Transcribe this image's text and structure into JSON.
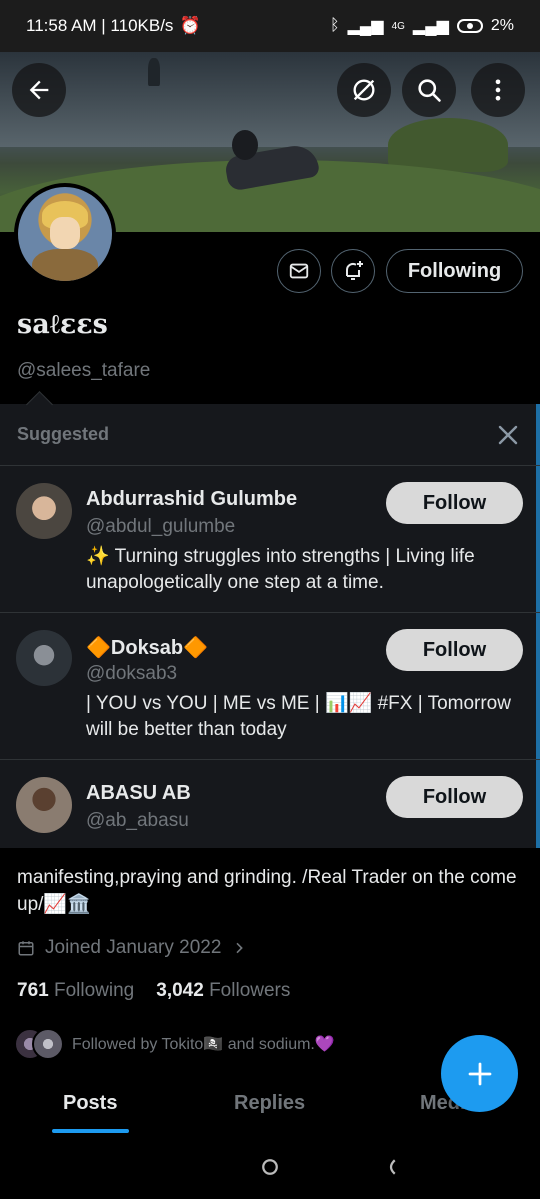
{
  "status_bar": {
    "time": "11:58 AM | 110KB/s",
    "signal_label": "4G",
    "battery": "2%"
  },
  "profile": {
    "display_name": "saℓεεs",
    "handle": "@salees_tafare",
    "following_button": "Following",
    "bio": "manifesting,praying and grinding. /Real Trader on the come up/📈🏛️",
    "joined": "Joined January 2022",
    "following_count": "761",
    "following_label": "Following",
    "followers_count": "3,042",
    "followers_label": "Followers",
    "followed_by": "Followed by Tokito🏴‍☠️ and sodium.💜"
  },
  "suggested": {
    "title": "Suggested",
    "users": [
      {
        "name": "Abdurrashid Gulumbe",
        "handle": "@abdul_gulumbe",
        "bio": "✨ Turning struggles into strengths | Living life unapologetically one step at a time.",
        "button": "Follow"
      },
      {
        "name": "🔶Doksab🔶",
        "handle": "@doksab3",
        "bio": "| YOU vs YOU | ME vs ME | 📊📈 #FX | Tomorrow will be better than today",
        "button": "Follow"
      },
      {
        "name": "ABASU AB",
        "handle": "@ab_abasu",
        "bio": "",
        "button": "Follow"
      }
    ]
  },
  "tabs": [
    {
      "label": "Posts"
    },
    {
      "label": "Replies"
    },
    {
      "label": "Media"
    }
  ],
  "colors": {
    "accent": "#1d9bf0",
    "background": "#000000",
    "muted": "#71767b"
  }
}
